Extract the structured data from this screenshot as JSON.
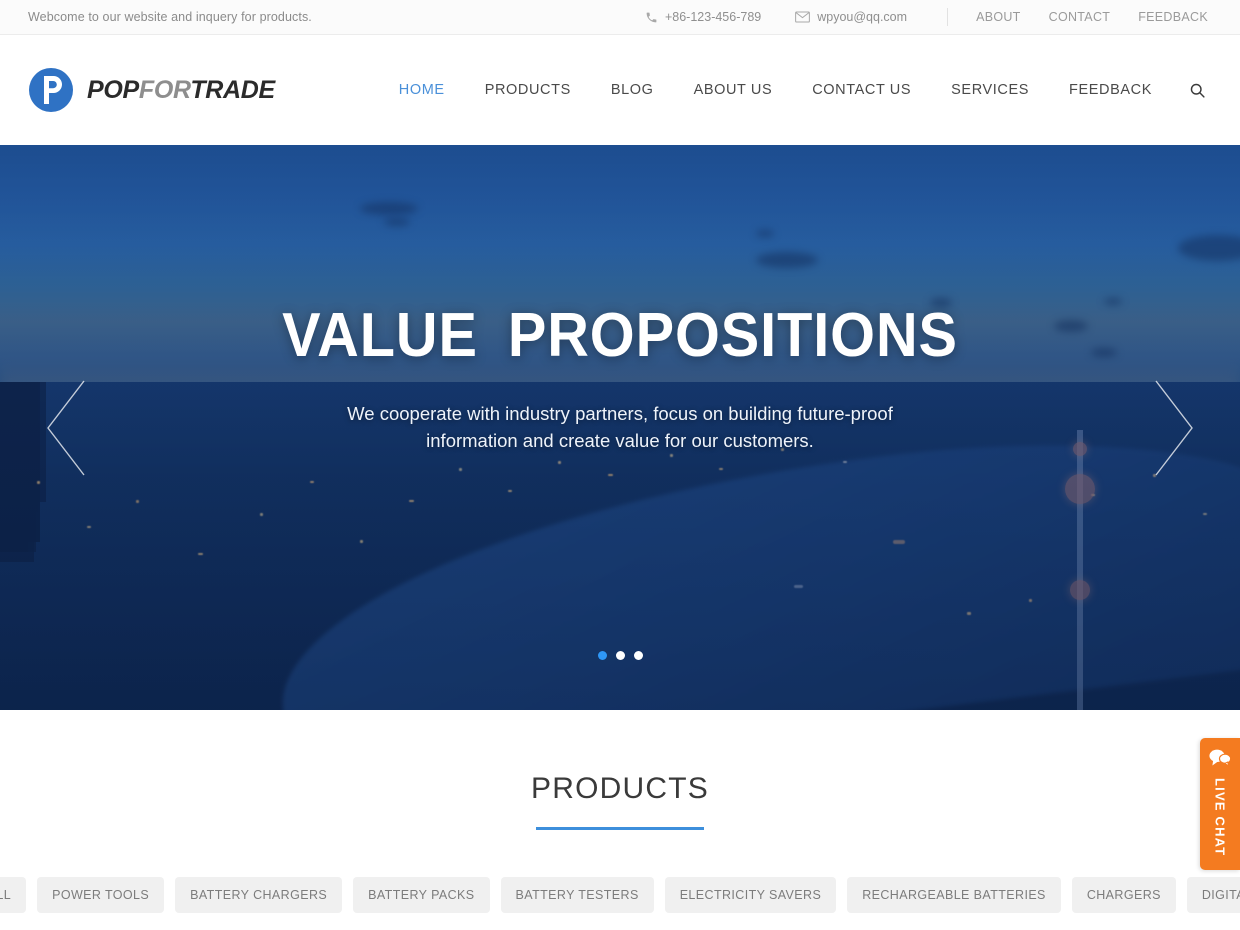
{
  "topbar": {
    "welcome": "Webcome to our website and inquery for products.",
    "phone": "+86-123-456-789",
    "email": "wpyou@qq.com",
    "links": [
      {
        "label": "ABOUT"
      },
      {
        "label": "CONTACT"
      },
      {
        "label": "FEEDBACK"
      }
    ]
  },
  "brand": {
    "part1": "POP",
    "part2": "FOR",
    "part3": "TRADE",
    "mark_color": "#2f72c4"
  },
  "nav": {
    "items": [
      {
        "label": "HOME",
        "active": true
      },
      {
        "label": "PRODUCTS",
        "active": false
      },
      {
        "label": "BLOG",
        "active": false
      },
      {
        "label": "ABOUT US",
        "active": false
      },
      {
        "label": "CONTACT US",
        "active": false
      },
      {
        "label": "SERVICES",
        "active": false
      },
      {
        "label": "FEEDBACK",
        "active": false
      }
    ],
    "active_color": "#4a90d9",
    "search_icon": "search-icon"
  },
  "hero": {
    "title": "VALUE  PROPOSITIONS",
    "subtitle": "We cooperate with industry partners, focus on building future-proof information and create value for our customers.",
    "prev_icon": "chevron-left-icon",
    "next_icon": "chevron-right-icon",
    "slide_count": 3,
    "active_slide": 1,
    "dot_active_color": "#2e97f7"
  },
  "products": {
    "title": "PRODUCTS",
    "accent_color": "#3d8fdc",
    "filters": [
      {
        "label": "ALL"
      },
      {
        "label": "POWER TOOLS"
      },
      {
        "label": "BATTERY CHARGERS"
      },
      {
        "label": "BATTERY PACKS"
      },
      {
        "label": "BATTERY TESTERS"
      },
      {
        "label": "ELECTRICITY SAVERS"
      },
      {
        "label": "RECHARGEABLE BATTERIES"
      },
      {
        "label": "CHARGERS"
      },
      {
        "label": "DIGITAL"
      }
    ]
  },
  "livechat": {
    "label": "LIVE CHAT",
    "color": "#f47b20",
    "icon": "chat-bubble-icon"
  }
}
